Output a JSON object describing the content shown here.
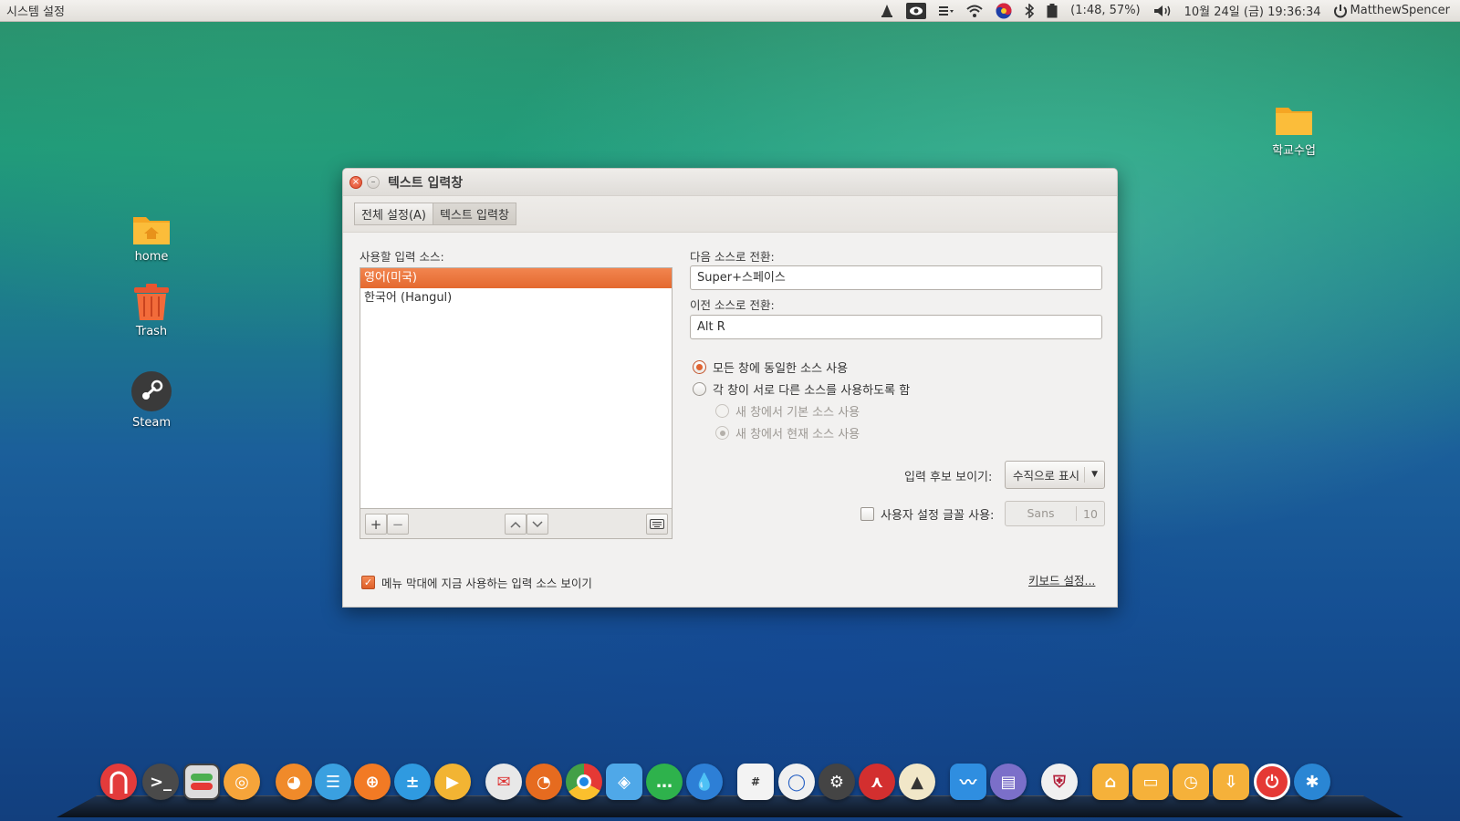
{
  "menubar": {
    "app_title": "시스템 설정",
    "battery_text": "(1:48, 57%)",
    "datetime": "10월 24일 (금) 19:36:34",
    "user": "MatthewSpencer",
    "tray_icons": [
      "vlc-icon",
      "eye-icon",
      "input-menu-icon",
      "wifi-icon",
      "korean-ime-icon",
      "bluetooth-icon",
      "battery-icon",
      "volume-icon",
      "session-icon"
    ]
  },
  "desktop": {
    "icons": [
      {
        "label": "home",
        "icon": "home-folder-icon"
      },
      {
        "label": "Trash",
        "icon": "trash-icon"
      },
      {
        "label": "Steam",
        "icon": "steam-icon"
      },
      {
        "label": "학교수업",
        "icon": "folder-icon"
      }
    ]
  },
  "window": {
    "title": "텍스트 입력창",
    "breadcrumbs": [
      "전체 설정(A)",
      "텍스트 입력창"
    ],
    "sources_label": "사용할 입력 소스:",
    "sources": [
      "영어(미국)",
      "한국어 (Hangul)"
    ],
    "selected_source_index": 0,
    "next_source_label": "다음 소스로 전환:",
    "next_source_value": "Super+스페이스",
    "prev_source_label": "이전 소스로 전환:",
    "prev_source_value": "Alt R",
    "radio_same": "모든 창에 동일한 소스 사용",
    "radio_diff": "각 창이 서로 다른 소스를 사용하도록 함",
    "radio_new_default": "새 창에서 기본 소스 사용",
    "radio_new_current": "새 창에서 현재 소스 사용",
    "candidates_label": "입력 후보 보이기:",
    "candidates_value": "수직으로 표시",
    "custom_font_label": "사용자 설정 글꼴 사용:",
    "font_name": "Sans",
    "font_size": "10",
    "show_in_menubar_label": "메뉴 막대에 지금 사용하는 입력 소스 보이기",
    "show_in_menubar_checked": true,
    "keyboard_settings_link": "키보드 설정..."
  },
  "dock": {
    "items": [
      "magnet-app-icon",
      "terminal-icon",
      "system-settings-icon",
      "screenshot-icon",
      "gimp-icon",
      "text-editor-icon",
      "basketball-icon",
      "calculator-icon",
      "video-player-icon",
      "mail-icon",
      "firefox-icon",
      "chrome-icon",
      "safari-icon",
      "messages-icon",
      "drop-icon",
      "sudoku-icon",
      "circle-app-icon",
      "steam-icon",
      "pdf-icon",
      "inkscape-icon",
      "system-monitor-icon",
      "files-icon",
      "shield-icon",
      "home-folder-icon",
      "documents-folder-icon",
      "recent-folder-icon",
      "downloads-folder-icon",
      "power-icon",
      "accessibility-icon"
    ]
  },
  "colors": {
    "accent": "#e4692f",
    "menubar": "#e9e6e2"
  }
}
